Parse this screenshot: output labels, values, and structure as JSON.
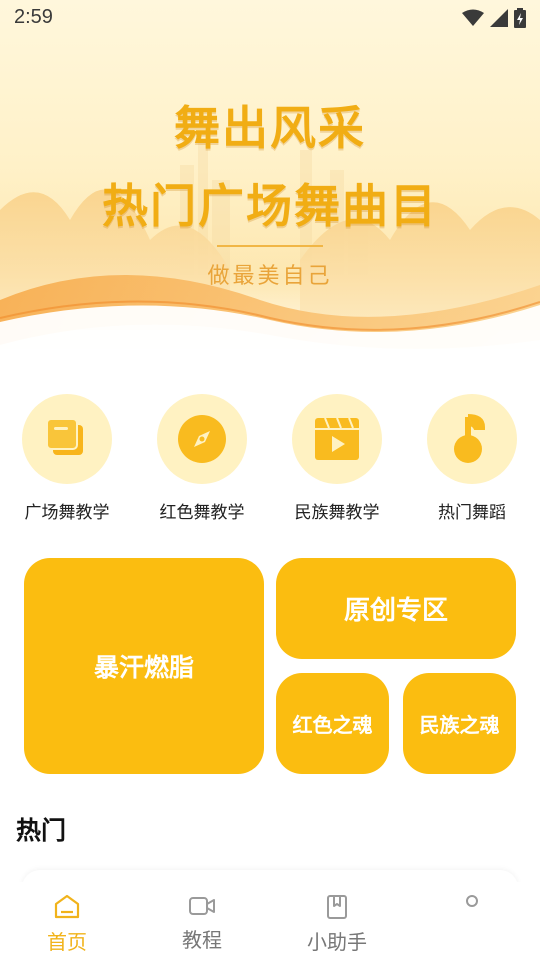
{
  "status": {
    "time": "2:59"
  },
  "hero": {
    "title_line1": "舞出风采",
    "title_line2": "热门广场舞曲目",
    "subtitle": "做最美自己"
  },
  "categories": [
    {
      "label": "广场舞教学",
      "icon": "pages-icon"
    },
    {
      "label": "红色舞教学",
      "icon": "compass-icon"
    },
    {
      "label": "民族舞教学",
      "icon": "video-icon"
    },
    {
      "label": "热门舞蹈",
      "icon": "music-note-icon"
    }
  ],
  "tiles": {
    "sweat": "暴汗燃脂",
    "original": "原创专区",
    "red": "红色之魂",
    "ethnic": "民族之魂"
  },
  "section": {
    "hot": "热门"
  },
  "tabbar": {
    "items": [
      {
        "label": "首页",
        "icon": "home-icon",
        "active": true
      },
      {
        "label": "教程",
        "icon": "video-camera-icon",
        "active": false
      },
      {
        "label": "小助手",
        "icon": "bookmark-book-icon",
        "active": false
      }
    ]
  },
  "colors": {
    "accent": "#fbbd10",
    "accent_light": "#fff2c2",
    "tab_active": "#f1b31b"
  }
}
